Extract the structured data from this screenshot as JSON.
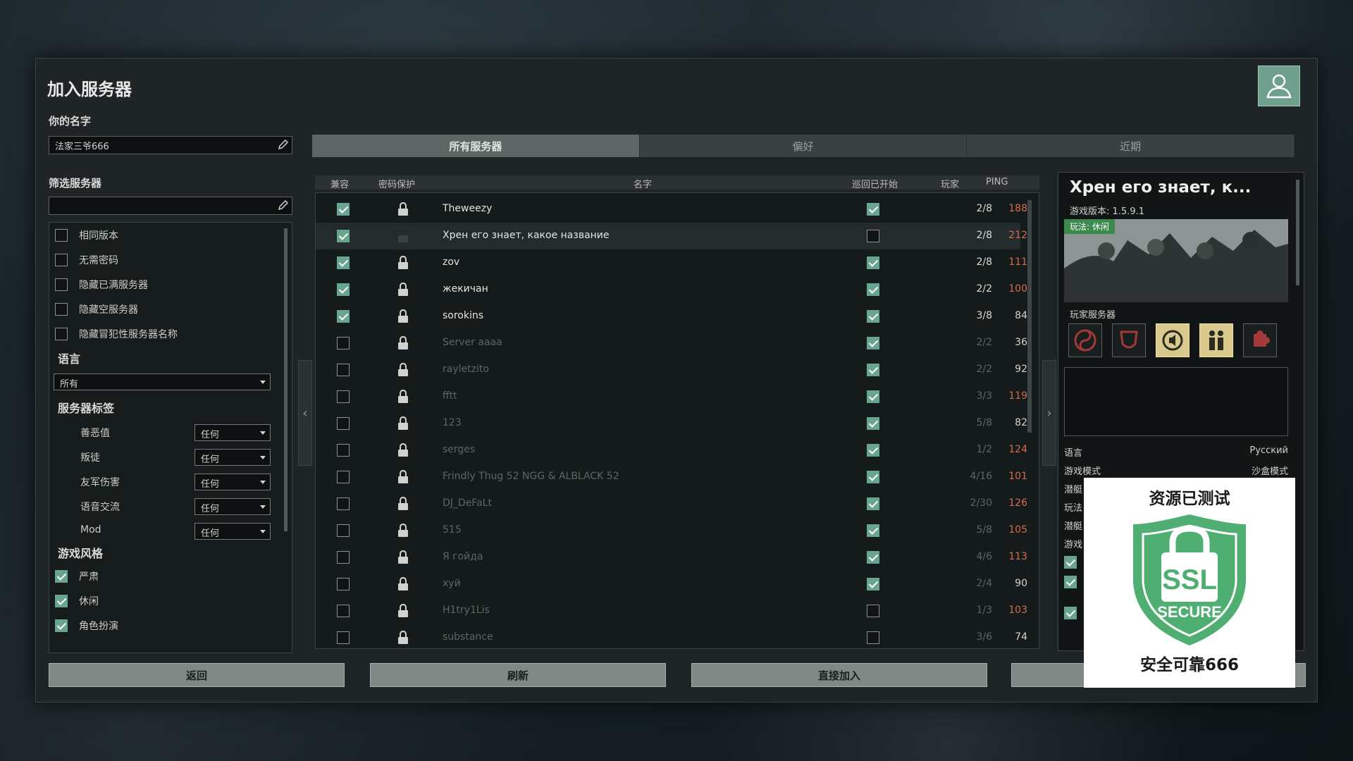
{
  "window": {
    "title": "加入服务器"
  },
  "your_name": {
    "label": "你的名字",
    "value": "法家三爷666"
  },
  "filter": {
    "label": "筛选服务器",
    "search_value": "",
    "options": [
      {
        "label": "相同版本",
        "checked": false
      },
      {
        "label": "无需密码",
        "checked": false
      },
      {
        "label": "隐藏已满服务器",
        "checked": false
      },
      {
        "label": "隐藏空服务器",
        "checked": false
      },
      {
        "label": "隐藏冒犯性服务器名称",
        "checked": false
      }
    ],
    "language": {
      "label": "语言",
      "value": "所有"
    },
    "server_tags": {
      "label": "服务器标签",
      "items": [
        {
          "label": "善恶值",
          "value": "任何"
        },
        {
          "label": "叛徒",
          "value": "任何"
        },
        {
          "label": "友军伤害",
          "value": "任何"
        },
        {
          "label": "语音交流",
          "value": "任何"
        },
        {
          "label": "Mod",
          "value": "任何"
        }
      ]
    },
    "game_style": {
      "label": "游戏风格",
      "items": [
        {
          "label": "严肃",
          "checked": true
        },
        {
          "label": "休闲",
          "checked": true
        },
        {
          "label": "角色扮演",
          "checked": true
        }
      ]
    }
  },
  "tabs": [
    "所有服务器",
    "偏好",
    "近期"
  ],
  "table": {
    "headers": {
      "compat": "兼容",
      "password": "密码保护",
      "name": "名字",
      "round": "巡回已开始",
      "players": "玩家",
      "ping": "PING"
    },
    "rows": [
      {
        "compat": true,
        "locked": true,
        "name": "Theweezy",
        "round": true,
        "players": "2/8",
        "ping": "188",
        "dim": false,
        "sel": false
      },
      {
        "compat": true,
        "locked": false,
        "name": "Хрен его знает, какое название",
        "round": false,
        "players": "2/8",
        "ping": "212",
        "dim": false,
        "sel": true
      },
      {
        "compat": true,
        "locked": true,
        "name": "zov",
        "round": true,
        "players": "2/8",
        "ping": "111",
        "dim": false,
        "sel": false
      },
      {
        "compat": true,
        "locked": true,
        "name": "жекичан",
        "round": true,
        "players": "2/2",
        "ping": "100",
        "dim": false,
        "sel": false
      },
      {
        "compat": true,
        "locked": true,
        "name": "sorokins",
        "round": true,
        "players": "3/8",
        "ping": "84",
        "dim": false,
        "sel": false
      },
      {
        "compat": false,
        "locked": true,
        "name": "Server aaaa",
        "round": true,
        "players": "2/2",
        "ping": "36",
        "dim": true,
        "sel": false
      },
      {
        "compat": false,
        "locked": true,
        "name": "rayletzito",
        "round": true,
        "players": "2/2",
        "ping": "92",
        "dim": true,
        "sel": false
      },
      {
        "compat": false,
        "locked": true,
        "name": "fftt",
        "round": true,
        "players": "3/3",
        "ping": "119",
        "dim": true,
        "sel": false
      },
      {
        "compat": false,
        "locked": true,
        "name": "123",
        "round": true,
        "players": "5/8",
        "ping": "82",
        "dim": true,
        "sel": false
      },
      {
        "compat": false,
        "locked": true,
        "name": "serges",
        "round": true,
        "players": "1/2",
        "ping": "124",
        "dim": true,
        "sel": false
      },
      {
        "compat": false,
        "locked": true,
        "name": "Frindly Thug 52 NGG & ALBLACK 52",
        "round": true,
        "players": "4/16",
        "ping": "101",
        "dim": true,
        "sel": false
      },
      {
        "compat": false,
        "locked": true,
        "name": "DJ_DeFaLt",
        "round": true,
        "players": "2/30",
        "ping": "126",
        "dim": true,
        "sel": false
      },
      {
        "compat": false,
        "locked": true,
        "name": "515",
        "round": true,
        "players": "5/8",
        "ping": "105",
        "dim": true,
        "sel": false
      },
      {
        "compat": false,
        "locked": true,
        "name": "Я гойда",
        "round": true,
        "players": "4/6",
        "ping": "113",
        "dim": true,
        "sel": false
      },
      {
        "compat": false,
        "locked": true,
        "name": "хуй",
        "round": true,
        "players": "2/4",
        "ping": "90",
        "dim": true,
        "sel": false
      },
      {
        "compat": false,
        "locked": true,
        "name": "H1try1Lis",
        "round": false,
        "players": "1/3",
        "ping": "103",
        "dim": true,
        "sel": false
      },
      {
        "compat": false,
        "locked": true,
        "name": "substance",
        "round": false,
        "players": "3/6",
        "ping": "74",
        "dim": true,
        "sel": false
      }
    ]
  },
  "details": {
    "title": "Хрен его знает, к...",
    "version": "游戏版本: 1.5.9.1",
    "playstyle_badge": "玩法: 休闲",
    "server_type": "玩家服务器",
    "language_label": "语言",
    "language_value": "Русский",
    "gamemode_label": "游戏模式",
    "gamemode_value": "沙盒模式",
    "partial_rows": [
      "潜艇",
      "玩法",
      "潜艇",
      "游戏"
    ]
  },
  "buttons": {
    "back": "返回",
    "refresh": "刷新",
    "direct_join": "直接加入"
  },
  "overlay": {
    "top_text": "资源已测试",
    "bottom_text": "安全可靠666",
    "ssl": "SSL",
    "secure": "SECURE"
  },
  "colors": {
    "accent": "#69a48f",
    "ping_warn": "#d46d4e",
    "badge_green": "#3c8a4e",
    "shield_green": "#4fae72"
  }
}
